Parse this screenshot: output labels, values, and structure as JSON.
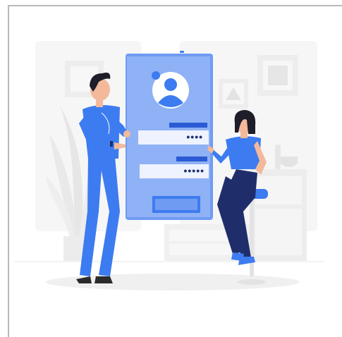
{
  "illustration": {
    "password_field_1_mask": "••••",
    "password_field_2_mask": "•••••",
    "colors": {
      "accent": "#3d7bf0",
      "accent_dark": "#2a5bd4",
      "navy": "#1f2e6b",
      "phone_bg": "#6f9bf2",
      "phone_screen": "#8fb1f5",
      "field": "#eef3ff",
      "light_gray": "#f2f2f2",
      "mid_gray": "#e3e3e3",
      "skin": "#f3b99a",
      "hair": "#1e1e2a"
    },
    "icons": [
      "user-avatar-icon",
      "lock-screen-icon"
    ]
  }
}
